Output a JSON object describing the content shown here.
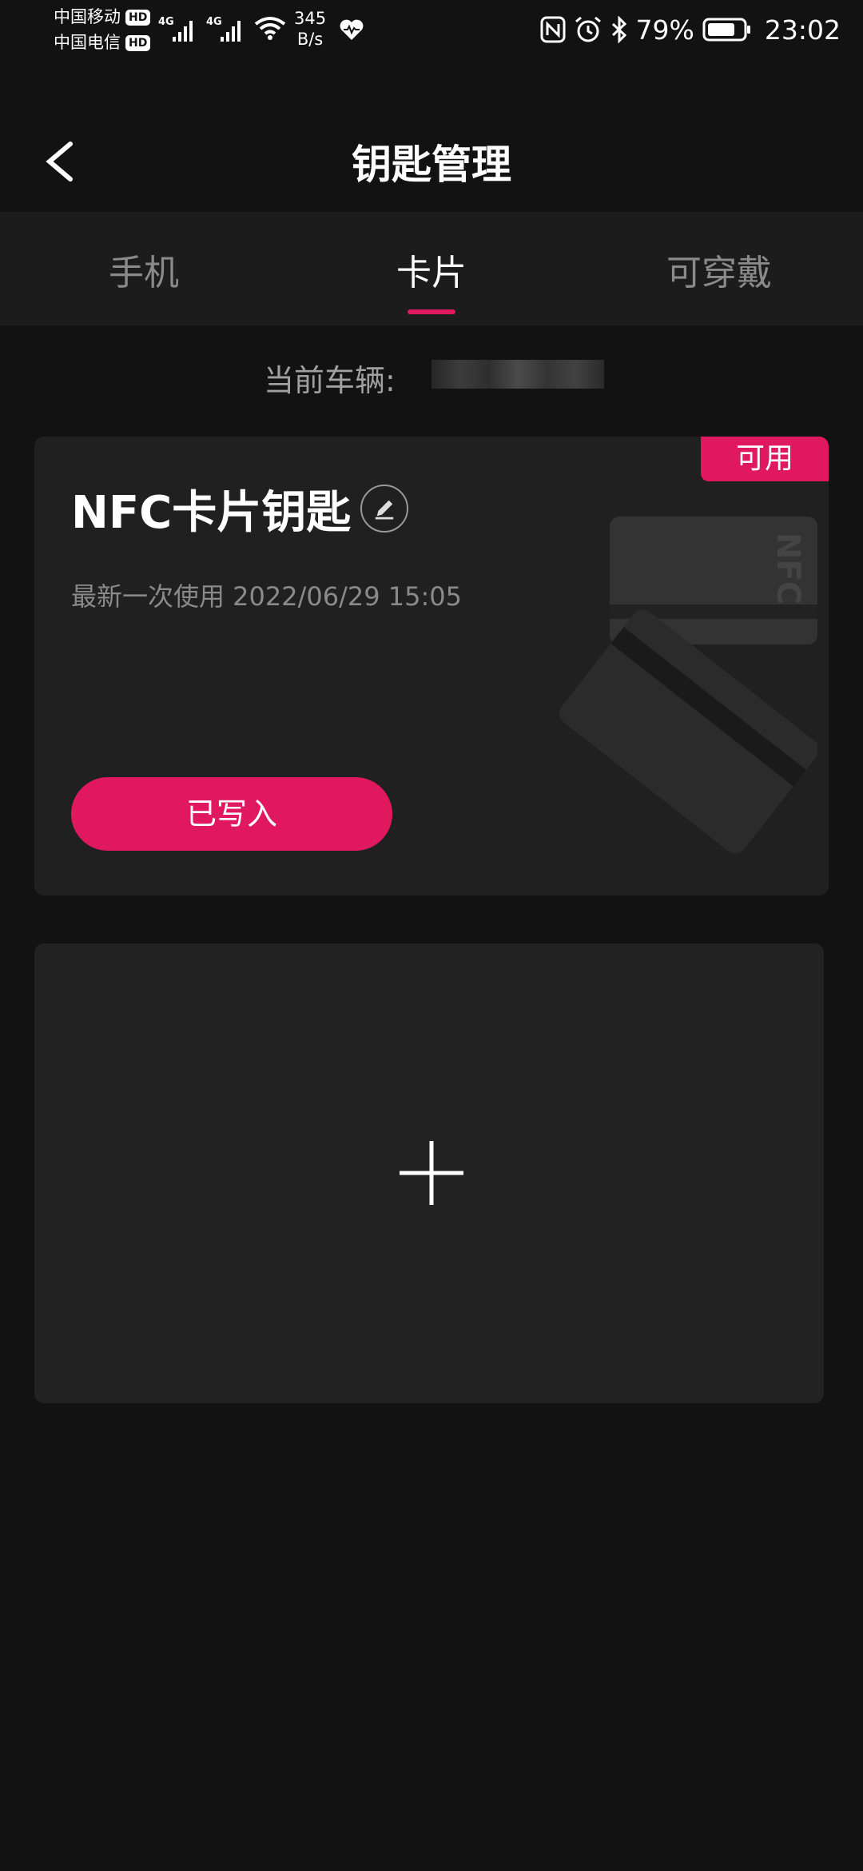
{
  "status_bar": {
    "carrier1": "中国移动",
    "carrier2": "中国电信",
    "hd_label": "HD",
    "network1": "4G",
    "network2": "4G",
    "net_speed_value": "345",
    "net_speed_unit": "B/s",
    "battery": "79%",
    "time": "23:02"
  },
  "header": {
    "title": "钥匙管理"
  },
  "tabs": [
    {
      "label": "手机"
    },
    {
      "label": "卡片"
    },
    {
      "label": "可穿戴"
    }
  ],
  "selected_tab": "卡片",
  "vehicle": {
    "label": "当前车辆:"
  },
  "key_card": {
    "badge": "可用",
    "name": "NFC卡片钥匙",
    "last_use": "最新一次使用 2022/06/29 15:05",
    "button": "已写入",
    "illustration_text": "NFC"
  },
  "colors": {
    "accent": "#e0185d",
    "background": "#121212",
    "card": "#202020"
  }
}
